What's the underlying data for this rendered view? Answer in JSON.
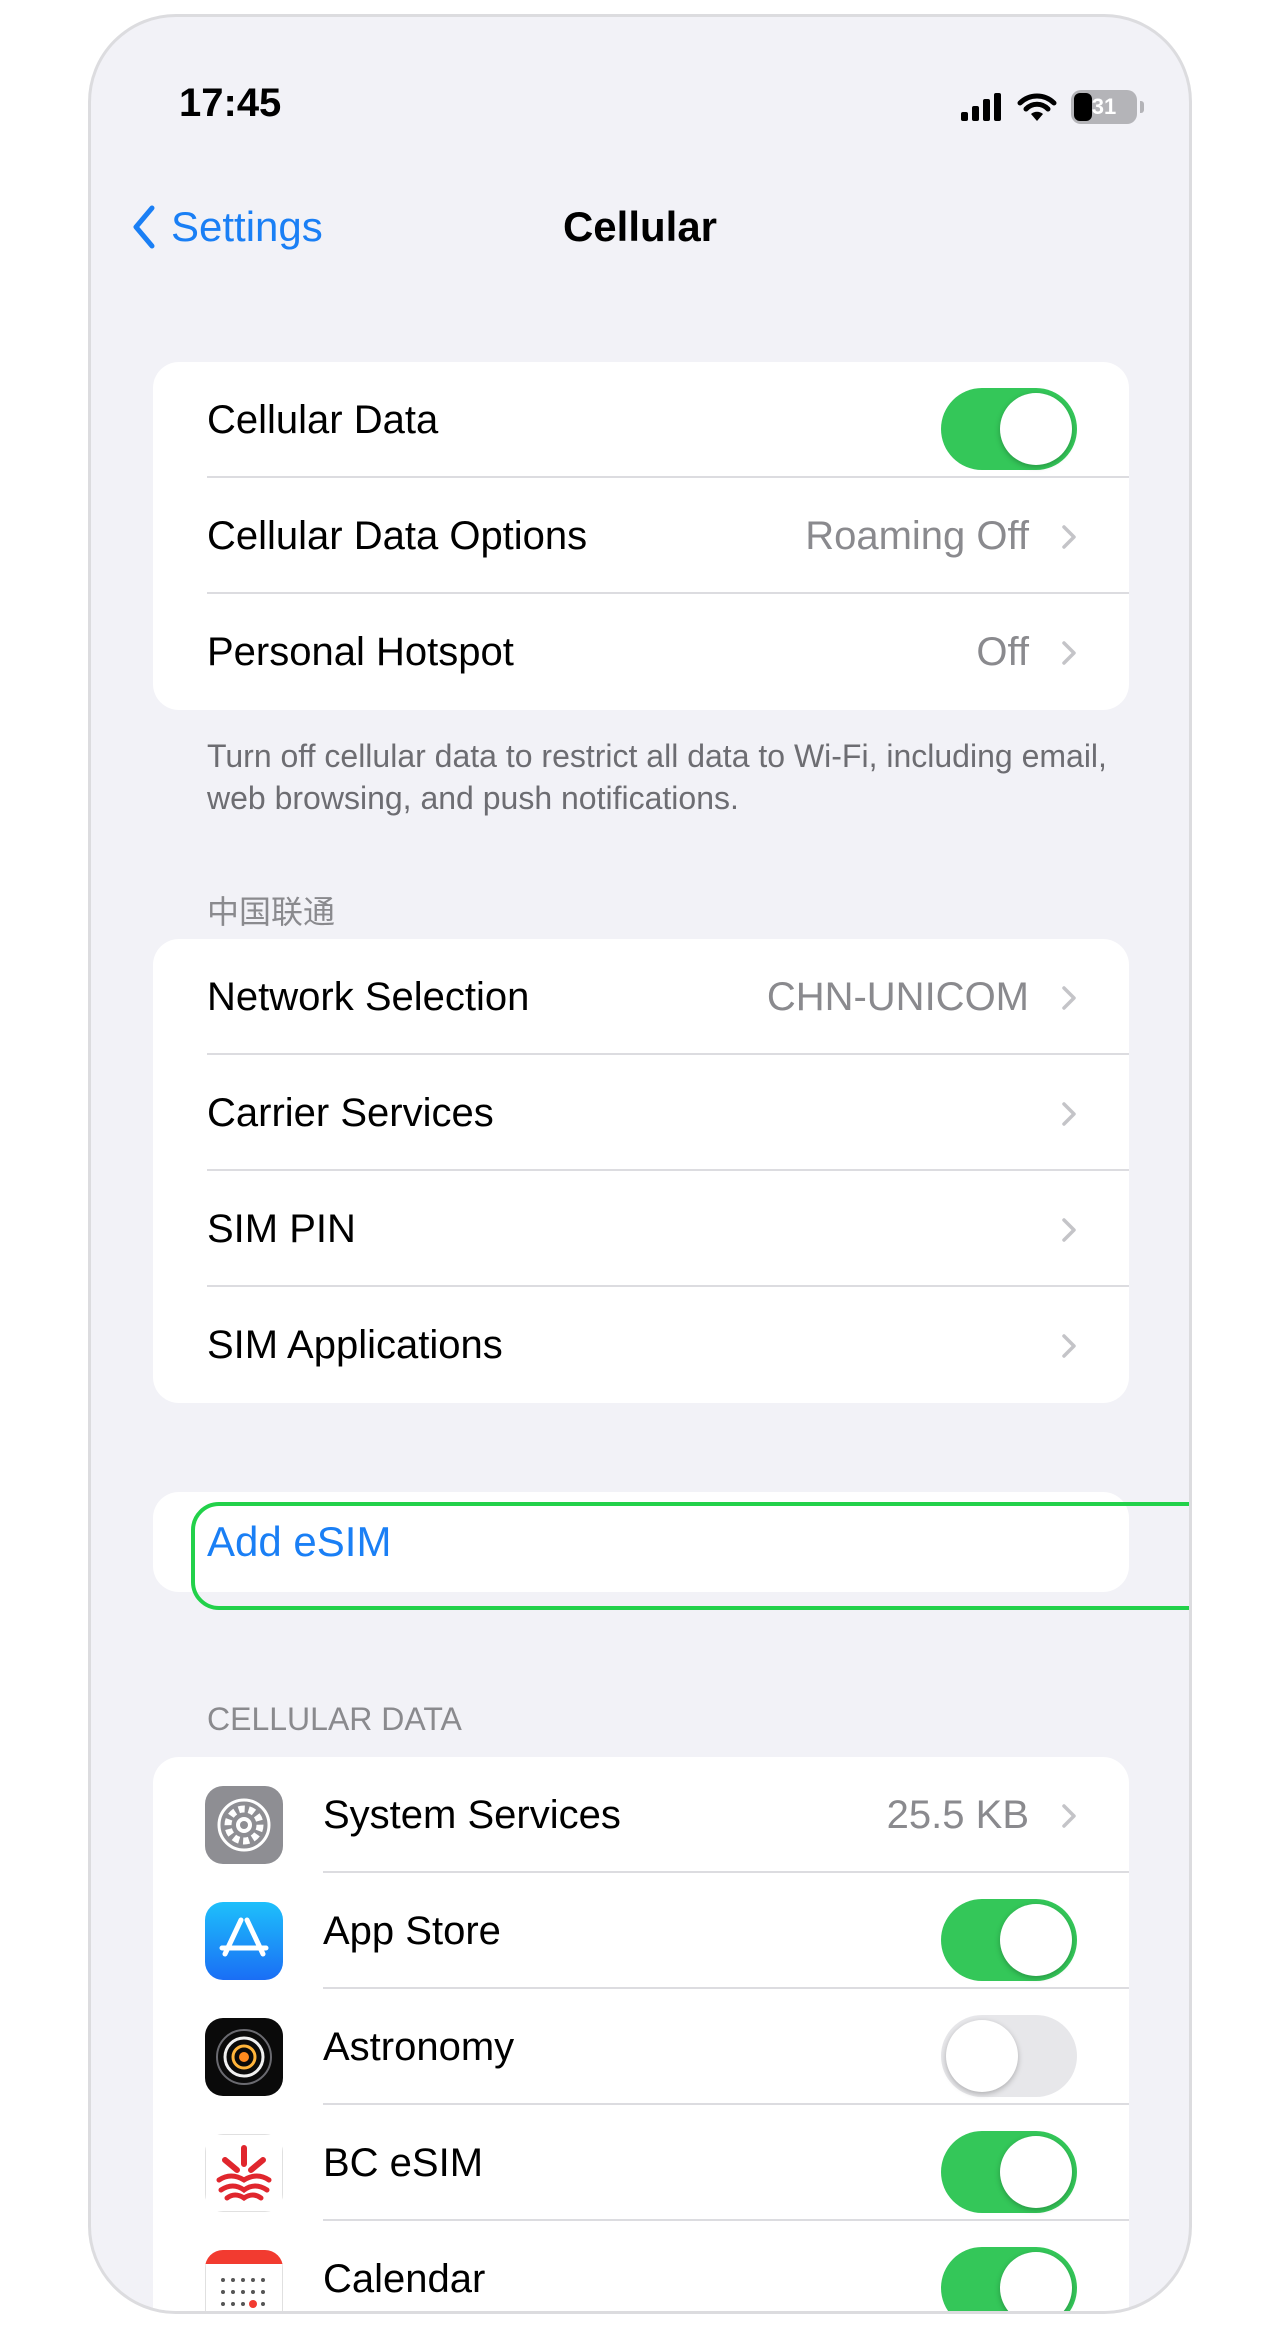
{
  "status_bar": {
    "time": "17:45",
    "battery": "31"
  },
  "nav": {
    "back_label": "Settings",
    "title": "Cellular"
  },
  "group1": {
    "rows": [
      {
        "label": "Cellular Data",
        "toggle_on": true
      },
      {
        "label": "Cellular Data Options",
        "value": "Roaming Off"
      },
      {
        "label": "Personal Hotspot",
        "value": "Off"
      }
    ],
    "footnote": "Turn off cellular data to restrict all data to Wi-Fi, including email, web browsing, and push notifications."
  },
  "carrier": {
    "header": "中国联通",
    "rows": [
      {
        "label": "Network Selection",
        "value": "CHN-UNICOM"
      },
      {
        "label": "Carrier Services"
      },
      {
        "label": "SIM PIN"
      },
      {
        "label": "SIM Applications"
      }
    ]
  },
  "add_esim": {
    "label": "Add eSIM"
  },
  "cellular_data": {
    "header": "CELLULAR DATA",
    "apps": [
      {
        "label": "System Services",
        "value": "25.5 KB",
        "icon": "gear-icon"
      },
      {
        "label": "App Store",
        "toggle_on": true,
        "icon": "app-store-icon"
      },
      {
        "label": "Astronomy",
        "toggle_on": false,
        "icon": "astronomy-icon"
      },
      {
        "label": "BC eSIM",
        "toggle_on": true,
        "icon": "bc-esim-icon"
      },
      {
        "label": "Calendar",
        "toggle_on": true,
        "icon": "calendar-icon"
      }
    ]
  },
  "colors": {
    "accent": "#1a7ff5",
    "toggle_on": "#34c759",
    "highlight": "#22d14a",
    "background": "#f2f2f7"
  }
}
